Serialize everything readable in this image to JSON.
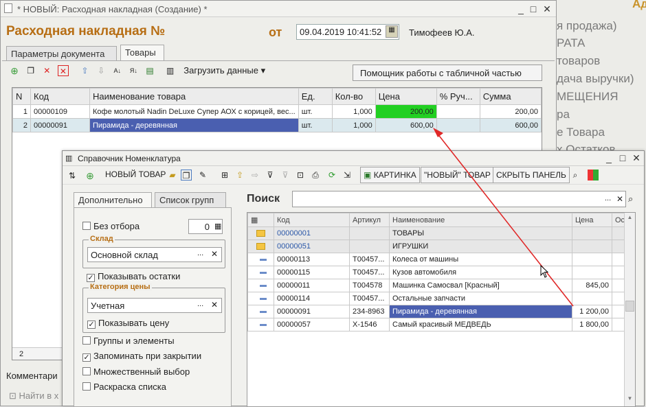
{
  "main_window": {
    "title": "* НОВЫЙ: Расходная накладная (Создание) *",
    "doc_title": "Расходная накладная №",
    "date_label": "от",
    "date_value": "09.04.2019 10:41:52",
    "author": "Тимофеев Ю.А.",
    "tabs": [
      "Параметры документа",
      "Товары"
    ],
    "active_tab": "Товары",
    "load_data_label": "Загрузить данные",
    "helper_button": "Помощник работы с табличной частью",
    "columns": [
      "N",
      "Код",
      "Наименование товара",
      "Ед.",
      "Кол-во",
      "Цена",
      "% Руч...",
      "Сумма"
    ],
    "rows": [
      {
        "n": "1",
        "code": "00000109",
        "name": "Кофе молотый Nadin DeLuxe Супер АОХ с корицей, вес...",
        "unit": "шт.",
        "qty": "1,000",
        "price": "200,00",
        "pct": "",
        "sum": "200,00"
      },
      {
        "n": "2",
        "code": "00000091",
        "name": "Пирамида - деревянная",
        "unit": "шт.",
        "qty": "1,000",
        "price": "600,00",
        "pct": "",
        "sum": "600,00"
      }
    ],
    "footer_count": "2",
    "comment_label": "Комментари",
    "find_label": "Найти в х"
  },
  "right_menu": [
    "я продажа)",
    "РАТА",
    "товаров",
    "дача выручки)",
    "МЕЩЕНИЯ",
    "ра",
    "е Товара",
    "х Остатков"
  ],
  "right_top": "Ад",
  "catalog_window": {
    "title": "Справочник Номенклатура",
    "toolbar": {
      "new_item": "НОВЫЙ ТОВАР",
      "picture": "КАРТИНКА",
      "new_quoted": "\"НОВЫЙ\" ТОВАР",
      "hide_panel": "СКРЫТЬ ПАНЕЛЬ"
    },
    "left_tabs": [
      "Дополнительно",
      "Список групп"
    ],
    "no_filter": "Без отбора",
    "no_filter_value": "0",
    "warehouse_label": "Склад",
    "warehouse_value": "Основной склад",
    "show_stock": "Показывать остатки",
    "price_cat_label": "Категория цены",
    "price_cat_value": "Учетная",
    "show_price": "Показывать цену",
    "groups_elements": "Группы и элементы",
    "remember_close": "Запоминать при закрытии",
    "multi_select": "Множественный выбор",
    "coloring": "Раскраска списка",
    "search_label": "Поиск",
    "columns": [
      "Код",
      "Артикул",
      "Наименование",
      "Цена",
      "Ос"
    ],
    "rows": [
      {
        "type": "group",
        "code": "00000001",
        "article": "",
        "name": "ТОВАРЫ",
        "price": ""
      },
      {
        "type": "group",
        "code": "00000051",
        "article": "",
        "name": "ИГРУШКИ",
        "price": ""
      },
      {
        "type": "item",
        "code": "00000113",
        "article": "Т00457...",
        "name": "Колеса от машины",
        "price": ""
      },
      {
        "type": "item",
        "code": "00000115",
        "article": "Т00457...",
        "name": "Кузов автомобиля",
        "price": ""
      },
      {
        "type": "item",
        "code": "00000011",
        "article": "Т004578",
        "name": "Машинка Самосвал [Красный]",
        "price": "845,00"
      },
      {
        "type": "item",
        "code": "00000114",
        "article": "Т00457...",
        "name": "Остальные запчасти",
        "price": ""
      },
      {
        "type": "item",
        "code": "00000091",
        "article": "234-8963",
        "name": "Пирамида - деревянная",
        "price": "1 200,00",
        "selected": true
      },
      {
        "type": "item",
        "code": "00000057",
        "article": "Х-1546",
        "name": "Самый красивый МЕДВЕДЬ",
        "price": "1 800,00"
      }
    ]
  },
  "colors": {
    "accent": "#b76e14",
    "selection": "#4a5fb0",
    "price_highlight": "#22d022",
    "arrow": "#e02828"
  }
}
